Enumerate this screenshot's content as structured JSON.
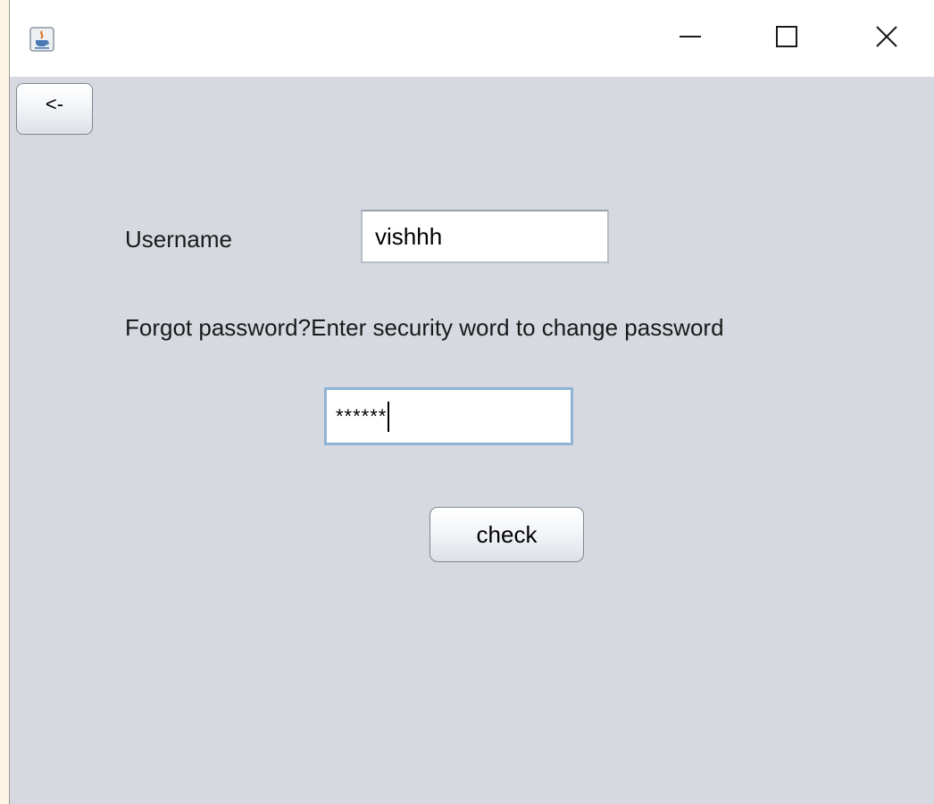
{
  "window": {
    "title": "",
    "controls": {
      "minimize_icon": "minimize-icon",
      "maximize_icon": "maximize-icon",
      "close_icon": "close-icon"
    },
    "app_icon": "java-cup-icon"
  },
  "toolbar": {
    "back_label": "<-"
  },
  "form": {
    "username_label": "Username",
    "username_value": "vishhh",
    "forgot_text": "Forgot password?Enter security word to change password",
    "security_value": "******",
    "check_label": "check"
  },
  "colors": {
    "window_background": "#d6d9e0",
    "titlebar_background": "#ffffff",
    "focus_border": "#8fb4d6",
    "desktop_background": "#fdf4e4"
  }
}
